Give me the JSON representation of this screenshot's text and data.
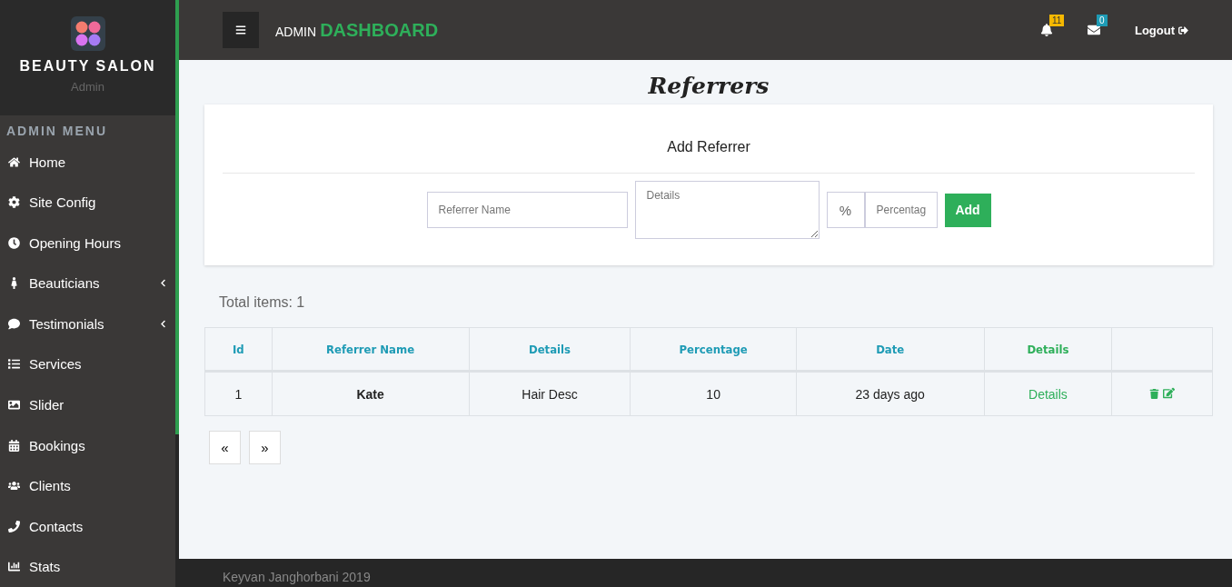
{
  "sidebar": {
    "brand": "BEAUTY SALON",
    "role": "Admin",
    "menu_title": "ADMIN MENU",
    "items": [
      {
        "label": "Home",
        "has_submenu": false
      },
      {
        "label": "Site Config",
        "has_submenu": false
      },
      {
        "label": "Opening Hours",
        "has_submenu": false
      },
      {
        "label": "Beauticians",
        "has_submenu": true
      },
      {
        "label": "Testimonials",
        "has_submenu": true
      },
      {
        "label": "Services",
        "has_submenu": false
      },
      {
        "label": "Slider",
        "has_submenu": false
      },
      {
        "label": "Bookings",
        "has_submenu": false
      },
      {
        "label": "Clients",
        "has_submenu": false
      },
      {
        "label": "Contacts",
        "has_submenu": false
      },
      {
        "label": "Stats",
        "has_submenu": false
      }
    ]
  },
  "topbar": {
    "title_small": "ADMIN",
    "title_large": "DASHBOARD",
    "notifications": "11",
    "messages": "0",
    "logout": "Logout"
  },
  "page_title": "Referrers",
  "form": {
    "heading": "Add Referrer",
    "name_placeholder": "Referrer Name",
    "details_placeholder": "Details",
    "percent_symbol": "%",
    "percentage_placeholder": "Percentag",
    "submit": "Add"
  },
  "total": "Total items: 1",
  "table": {
    "columns": [
      {
        "label": "Id",
        "color": "#1e9bb5"
      },
      {
        "label": "Referrer Name",
        "color": "#1e9bb5"
      },
      {
        "label": "Details",
        "color": "#1e9bb5"
      },
      {
        "label": "Percentage",
        "color": "#1e9bb5"
      },
      {
        "label": "Date",
        "color": "#1e9bb5"
      },
      {
        "label": "Details",
        "color": "#2eaf5a"
      },
      {}
    ],
    "rows": [
      {
        "id": "1",
        "name": "Kate",
        "details": "Hair Desc",
        "percentage": "10",
        "date": "23 days ago",
        "link": "Details"
      }
    ]
  },
  "pagination": [
    "«",
    "»"
  ],
  "footer": "Keyvan Janghorbani 2019"
}
